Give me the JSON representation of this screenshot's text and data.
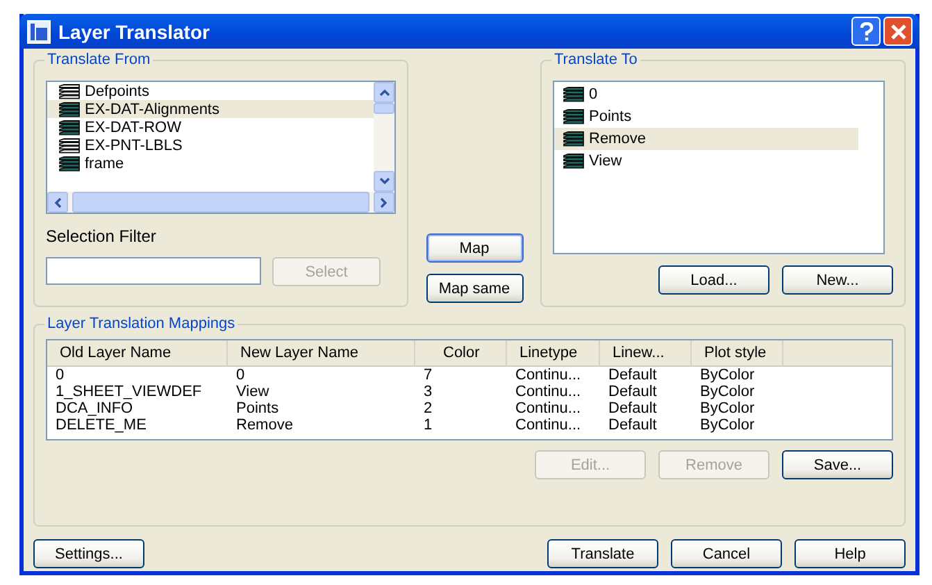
{
  "window": {
    "title": "Layer Translator"
  },
  "translate_from": {
    "label": "Translate From",
    "items": [
      {
        "name": "Defpoints",
        "used": false,
        "selected": false
      },
      {
        "name": "EX-DAT-Alignments",
        "used": true,
        "selected": true
      },
      {
        "name": "EX-DAT-ROW",
        "used": true,
        "selected": false
      },
      {
        "name": "EX-PNT-LBLS",
        "used": false,
        "selected": false
      },
      {
        "name": "frame",
        "used": true,
        "selected": false
      }
    ],
    "selection_filter": {
      "label": "Selection Filter"
    },
    "select_button": {
      "label": "Select",
      "disabled": true
    }
  },
  "middle_buttons": [
    {
      "label": "Map",
      "default": true
    },
    {
      "label": "Map same",
      "default": false
    }
  ],
  "translate_to": {
    "label": "Translate To",
    "items": [
      {
        "name": "0",
        "used": true,
        "selected": false
      },
      {
        "name": "Points",
        "used": true,
        "selected": false
      },
      {
        "name": "Remove",
        "used": true,
        "selected": true
      },
      {
        "name": "View",
        "used": true,
        "selected": false
      }
    ],
    "buttons": [
      {
        "label": "Load...",
        "disabled": false
      },
      {
        "label": "New...",
        "disabled": false
      }
    ]
  },
  "mappings": {
    "label": "Layer Translation Mappings",
    "columns": [
      "Old Layer Name",
      "New Layer Name",
      "Color",
      "Linetype",
      "Linew...",
      "Plot style"
    ],
    "rows": [
      [
        "0",
        "0",
        "7",
        "Continu...",
        "Default",
        "ByColor"
      ],
      [
        "1_SHEET_VIEWDEF",
        "View",
        "3",
        "Continu...",
        "Default",
        "ByColor"
      ],
      [
        "DCA_INFO",
        "Points",
        "2",
        "Continu...",
        "Default",
        "ByColor"
      ],
      [
        "DELETE_ME",
        "Remove",
        "1",
        "Continu...",
        "Default",
        "ByColor"
      ]
    ],
    "buttons": [
      {
        "label": "Edit...",
        "disabled": true
      },
      {
        "label": "Remove",
        "disabled": true
      },
      {
        "label": "Save...",
        "disabled": false
      }
    ]
  },
  "footer": {
    "left": [
      {
        "label": "Settings...",
        "disabled": false
      }
    ],
    "right": [
      {
        "label": "Translate",
        "disabled": false
      },
      {
        "label": "Cancel",
        "disabled": false
      },
      {
        "label": "Help",
        "disabled": false
      }
    ]
  }
}
